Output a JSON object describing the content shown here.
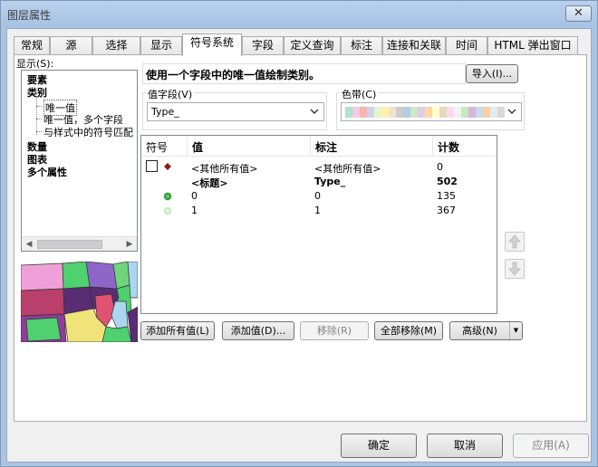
{
  "window": {
    "title": "图层属性",
    "close_glyph": "✕"
  },
  "tabs": [
    {
      "label": "常规"
    },
    {
      "label": "源"
    },
    {
      "label": "选择"
    },
    {
      "label": "显示"
    },
    {
      "label": "符号系统"
    },
    {
      "label": "字段"
    },
    {
      "label": "定义查询"
    },
    {
      "label": "标注"
    },
    {
      "label": "连接和关联"
    },
    {
      "label": "时间"
    },
    {
      "label": "HTML 弹出窗口"
    }
  ],
  "active_tab": 4,
  "show": {
    "label": "显示(S):",
    "tree": [
      {
        "label": "要素",
        "bold": true
      },
      {
        "label": "类别",
        "bold": true
      },
      {
        "label": "唯一值",
        "bold": false,
        "child": true,
        "selected": true
      },
      {
        "label": "唯一值，多个字段",
        "bold": false,
        "child": true
      },
      {
        "label": "与样式中的符号匹配",
        "bold": false,
        "child": true
      },
      {
        "label": "数量",
        "bold": true
      },
      {
        "label": "图表",
        "bold": true
      },
      {
        "label": "多个属性",
        "bold": true
      }
    ]
  },
  "description": "使用一个字段中的唯一值绘制类别。",
  "import_button": "导入(I)...",
  "value_field": {
    "label": "值字段(V)",
    "value": "Type_"
  },
  "color_ramp": {
    "label": "色带(C)",
    "colors": [
      "#b3e2cd",
      "#f4cae4",
      "#fbb4ae",
      "#cbd5e8",
      "#e6f5c9",
      "#fff2ae",
      "#f1e2cc",
      "#cccccc",
      "#b3cde3",
      "#ccebc5",
      "#decbe4",
      "#fed9a6",
      "#ffffcc",
      "#e5d8bd",
      "#fddaec",
      "#f2f2f2",
      "#c7e9c0",
      "#d4b9da",
      "#c6dbef",
      "#fdd0a2",
      "#e0ecf4",
      "#d9d9d9"
    ]
  },
  "table": {
    "headers": {
      "symbol": "符号",
      "value": "值",
      "label": "标注",
      "count": "计数"
    },
    "rows": [
      {
        "value": "<其他所有值>",
        "label": "<其他所有值>",
        "count": "0",
        "bold": false,
        "symbol": "other"
      },
      {
        "value": "<标题>",
        "label": "Type_",
        "count": "502",
        "bold": true,
        "symbol": "none"
      },
      {
        "value": "0",
        "label": "0",
        "count": "135",
        "bold": false,
        "symbol": "green-dark"
      },
      {
        "value": "1",
        "label": "1",
        "count": "367",
        "bold": false,
        "symbol": "green-light"
      }
    ]
  },
  "buttons": {
    "add_all": "添加所有值(L)",
    "add_values": "添加值(D)...",
    "remove": "移除(R)",
    "remove_all": "全部移除(M)",
    "advanced": "高级(N)"
  },
  "dialog": {
    "ok": "确定",
    "cancel": "取消",
    "apply": "应用(A)"
  },
  "icons": {
    "up": "arrow-up-icon",
    "down": "arrow-down-icon"
  }
}
